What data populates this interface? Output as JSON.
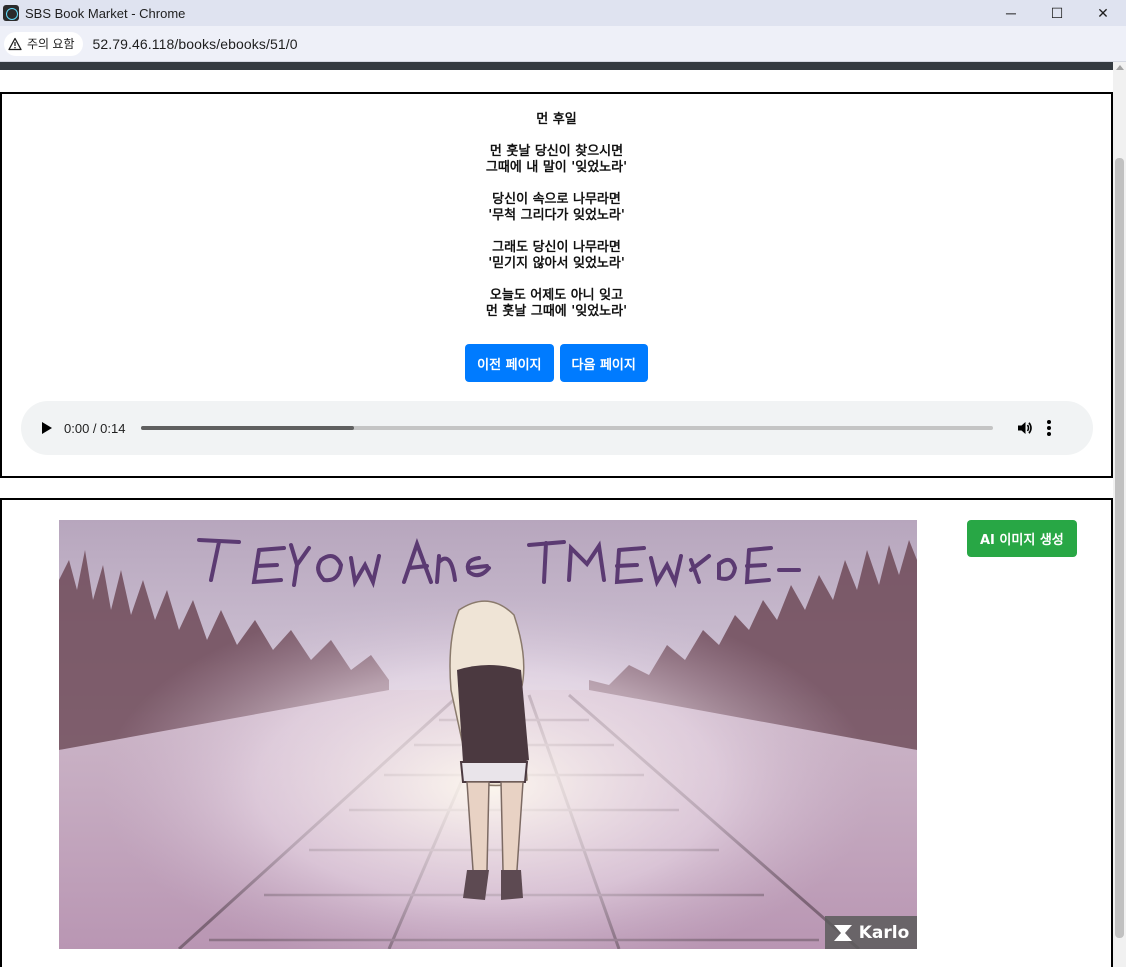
{
  "window": {
    "title": "SBS Book Market - Chrome",
    "controls": {
      "minimize": "─",
      "maximize": "☐",
      "close": "✕"
    }
  },
  "addressbar": {
    "security_label": "주의 요함",
    "url": "52.79.46.118/books/ebooks/51/0"
  },
  "ebook": {
    "title": "먼 후일",
    "stanzas": [
      [
        "먼 훗날 당신이 찾으시면",
        "그때에 내 말이 '잊었노라'"
      ],
      [
        "당신이 속으로 나무라면",
        "'무척 그리다가 잊었노라'"
      ],
      [
        "그래도 당신이 나무라면",
        "'믿기지 않아서 잊었노라'"
      ],
      [
        "오늘도 어제도 아니 잊고",
        "먼 훗날 그때에 '잊었노라'"
      ]
    ],
    "prev_label": "이전 페이지",
    "next_label": "다음 페이지"
  },
  "audio": {
    "time_display": "0:00 / 0:14",
    "progress_fraction": 0.25
  },
  "image_panel": {
    "generate_label": "AI 이미지 생성",
    "badge_label": "Karlo"
  },
  "colors": {
    "primary_button": "#007bff",
    "success_button": "#28a745",
    "nav_strip": "#343a40"
  }
}
